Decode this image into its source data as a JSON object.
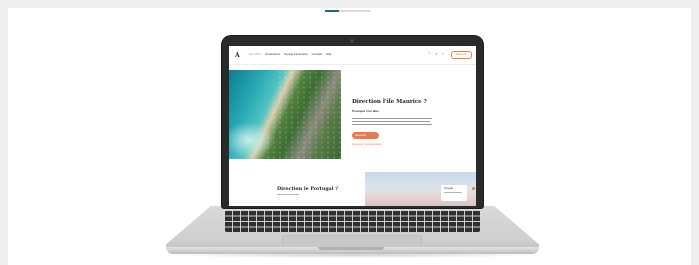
{
  "site_nav": {
    "logo": "A",
    "links": [
      "Nos offres",
      "Destinations",
      "Voyage d'entreprise",
      "Conseils",
      "Aide"
    ],
    "reserve_label": "Réserver",
    "icons": [
      "heart-icon",
      "search-icon",
      "user-icon"
    ]
  },
  "hero": {
    "title": "Direction l'île Maurice ?",
    "subtitle": "Pourquoi s'en aller",
    "cta_label": "Découvrir",
    "more_link": "Découvrez nos destinations"
  },
  "second_section": {
    "title": "Direction le Portugal ?",
    "card_label": "Portugal"
  },
  "colors": {
    "accent": "#e77a52",
    "laptop_frame": "#2a2a2a",
    "background": "#efefef"
  }
}
